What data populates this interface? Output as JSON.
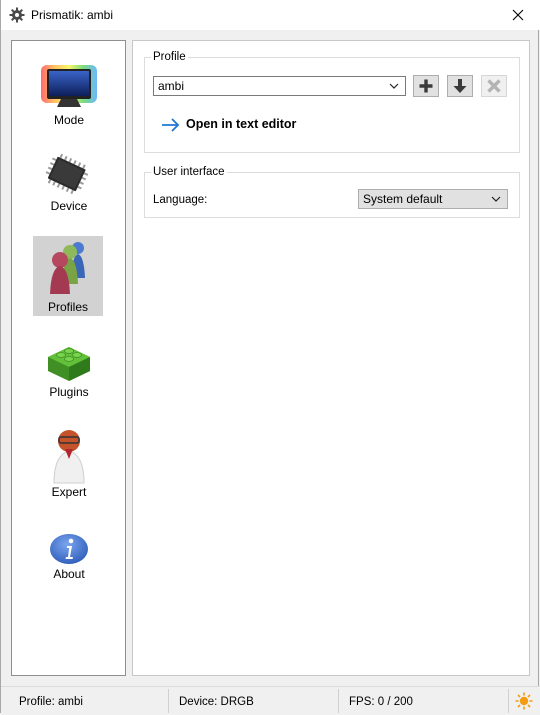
{
  "window": {
    "title": "Prismatik: ambi",
    "app_icon": "gear-icon",
    "close_icon": "close-icon"
  },
  "sidebar": {
    "items": [
      {
        "label": "Mode",
        "icon": "rainbow-monitor-icon"
      },
      {
        "label": "Device",
        "icon": "chip-icon"
      },
      {
        "label": "Profiles",
        "icon": "profiles-pawns-icon",
        "selected": true
      },
      {
        "label": "Plugins",
        "icon": "lego-brick-icon"
      },
      {
        "label": "Expert",
        "icon": "professor-icon"
      },
      {
        "label": "About",
        "icon": "info-icon"
      }
    ]
  },
  "profile_group": {
    "title": "Profile",
    "selected_profile": "ambi",
    "add_icon": "plus-icon",
    "save_icon": "arrow-down-icon",
    "delete_icon": "x-icon",
    "open_editor_label": "Open in text editor",
    "open_editor_icon": "arrow-right-icon"
  },
  "ui_group": {
    "title": "User interface",
    "language_label": "Language:",
    "language_value": "System default"
  },
  "statusbar": {
    "profile": "Profile: ambi",
    "device": "Device: DRGB",
    "fps": "FPS: 0 / 200",
    "state_icon": "sun-icon"
  },
  "colors": {
    "link_arrow": "#1f78d1",
    "sun": "#f39c12",
    "selected_nav": "#d2d2d2"
  }
}
